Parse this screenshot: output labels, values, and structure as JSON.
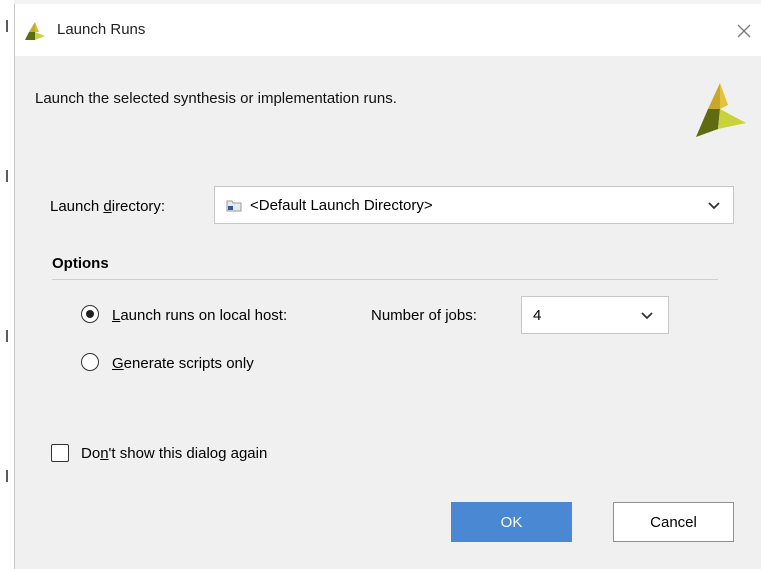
{
  "window": {
    "title": "Launch Runs",
    "close_icon": "close-icon"
  },
  "header": {
    "description": "Launch the selected synthesis or implementation runs."
  },
  "launch_directory": {
    "label_prefix": "Launch ",
    "label_mnemonic": "d",
    "label_suffix": "irectory:",
    "value": "<Default Launch Directory>"
  },
  "options": {
    "heading": "Options",
    "radio_local": {
      "mnemonic": "L",
      "rest": "aunch runs on local host:",
      "selected": true
    },
    "jobs": {
      "label_prefix": "Number of ",
      "label_mnemonic": "j",
      "label_suffix": "obs:",
      "value": "4"
    },
    "radio_scripts": {
      "mnemonic": "G",
      "rest": "enerate scripts only",
      "selected": false
    }
  },
  "dont_show": {
    "prefix": "Do",
    "mnemonic": "n",
    "suffix": "'t show this dialog again",
    "checked": false
  },
  "buttons": {
    "ok": "OK",
    "cancel": "Cancel"
  },
  "colors": {
    "accent": "#4a88d4",
    "logo_light": "#c8d23a",
    "logo_dark": "#5e6b10"
  }
}
